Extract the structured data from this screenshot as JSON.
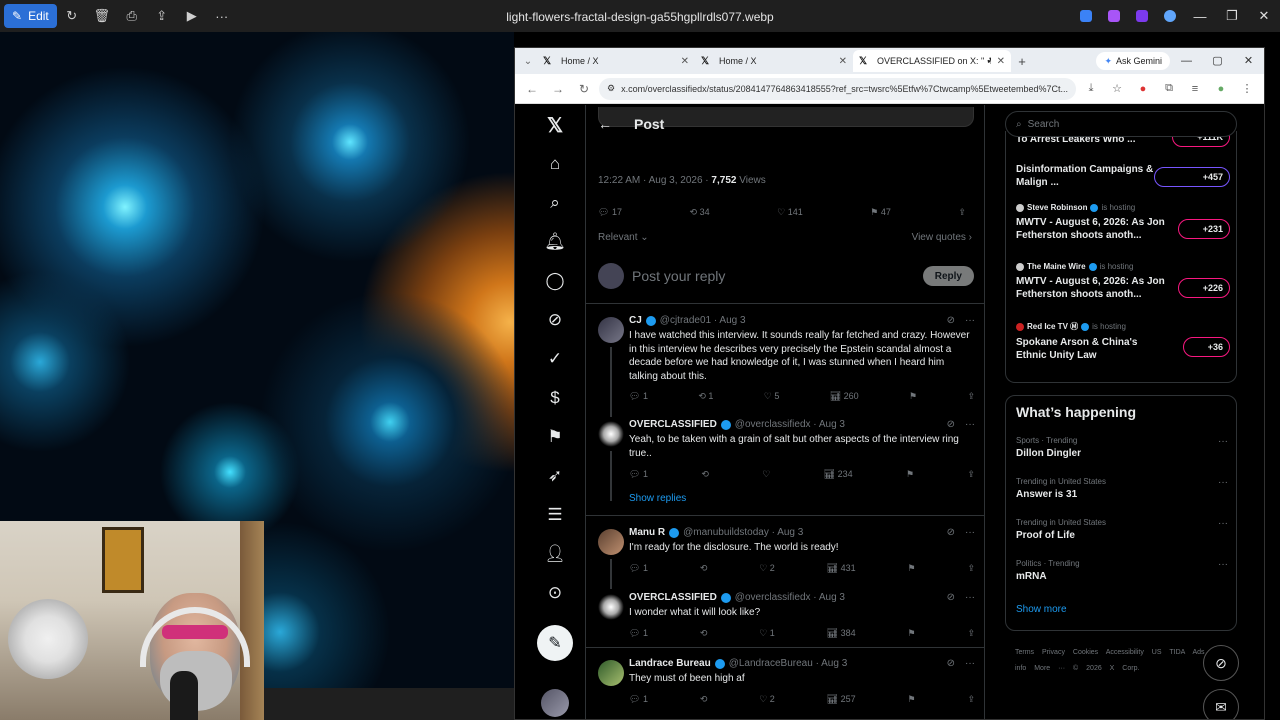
{
  "viewer": {
    "edit_label": "Edit",
    "title": "light-flowers-fractal-design-ga55hgpllrdls077.webp"
  },
  "browser": {
    "tabs": [
      {
        "label": "Home / X"
      },
      {
        "label": "Home / X"
      },
      {
        "label": "OVERCLASSIFIED on X: \" ☘ NA"
      }
    ],
    "ask_gemini": "Ask Gemini",
    "url": "x.com/overclassifiedx/status/2084147764863418555?ref_src=twsrc%5Etfw%7Ctwcamp%5Etweetembed%7Ct..."
  },
  "x": {
    "header_title": "Post",
    "post_meta": {
      "time": "12:22 AM · Aug 3, 2026 · ",
      "views": "7,752",
      "views_label": " Views"
    },
    "stats": {
      "replies": "17",
      "reposts": "34",
      "likes": "141",
      "bookmarks": "47"
    },
    "relevant": "Relevant",
    "view_quotes": "View quotes",
    "reply_placeholder": "Post your reply",
    "reply_button": "Reply",
    "show_replies": "Show replies",
    "tweets": [
      {
        "name": "CJ",
        "handle": "@cjtrade01 · Aug 3",
        "text": "I have watched this interview.  It sounds really far fetched and crazy. However in this interview he describes very precisely the Epstein scandal almost a decade before we had knowledge of it, I was stunned when I heard him talking about this.",
        "replies": "1",
        "reposts": "1",
        "likes": "5",
        "views": "260"
      },
      {
        "name": "OVERCLASSIFIED",
        "handle": "@overclassifiedx · Aug 3",
        "text": "Yeah, to be taken with a grain of salt but other aspects of the interview ring true..",
        "replies": "1",
        "reposts": "",
        "likes": "",
        "views": "234"
      },
      {
        "name": "Manu R",
        "handle": "@manubuildstoday · Aug 3",
        "text": "I'm ready for the disclosure. The world is ready!",
        "replies": "1",
        "reposts": "",
        "likes": "2",
        "views": "431"
      },
      {
        "name": "OVERCLASSIFIED",
        "handle": "@overclassifiedx · Aug 3",
        "text": "I wonder what it will look like?",
        "replies": "1",
        "reposts": "",
        "likes": "1",
        "views": "384"
      },
      {
        "name": "Landrace Bureau",
        "handle": "@LandraceBureau · Aug 3",
        "text": "They must of been high af",
        "replies": "1",
        "reposts": "",
        "likes": "2",
        "views": "257"
      }
    ],
    "search_placeholder": "Search",
    "spaces": [
      {
        "host": "",
        "title": "To Arrest Leakers Who ...",
        "count": "+111K",
        "color": "#f91880"
      },
      {
        "host": "",
        "title": "Disinformation Campaigns & Malign ...",
        "count": "+457",
        "color": "#7856ff"
      },
      {
        "host": "Steve Robinson",
        "hosting": "is hosting",
        "title": "MWTV - August 6, 2026: As Jon Fetherston shoots anoth...",
        "count": "+231",
        "color": "#f91880"
      },
      {
        "host": "The Maine Wire",
        "hosting": "is hosting",
        "title": "MWTV - August 6, 2026: As Jon Fetherston shoots anoth...",
        "count": "+226",
        "color": "#f91880"
      },
      {
        "host": "Red Ice TV Ⓜ",
        "hosting": "is hosting",
        "title": "Spokane Arson & China's Ethnic Unity Law",
        "count": "+36",
        "color": "#f91880"
      }
    ],
    "happening_title": "What’s happening",
    "trends": [
      {
        "context": "Sports · Trending",
        "title": "Dillon Dingler"
      },
      {
        "context": "Trending in United States",
        "title": "Answer is 31"
      },
      {
        "context": "Trending in United States",
        "title": "Proof of Life"
      },
      {
        "context": "Politics · Trending",
        "title": "mRNA"
      }
    ],
    "show_more": "Show more",
    "footer": "Terms  Privacy  Cookies  Accessibility  US TIDA  Ads info  More ···  © 2026 X Corp."
  }
}
